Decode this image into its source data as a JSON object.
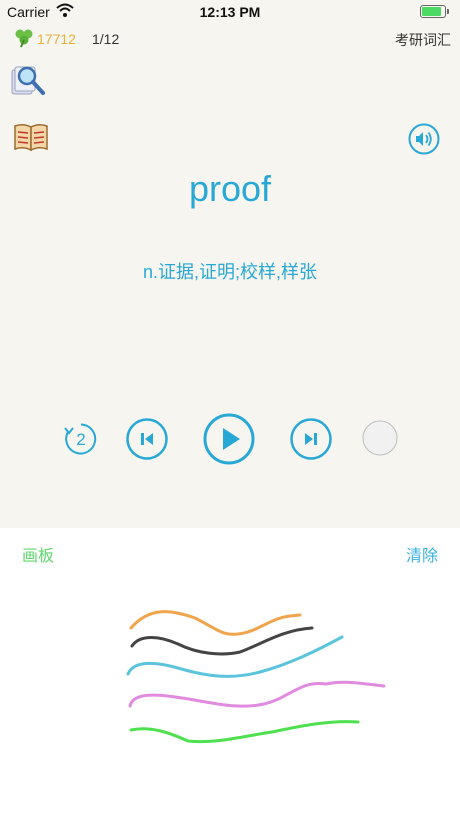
{
  "status_bar": {
    "carrier": "Carrier",
    "time": "12:13 PM"
  },
  "header": {
    "score": "17712",
    "progress": "1/12",
    "wordbook": "考研词汇"
  },
  "card": {
    "word": "proof",
    "definition": "n.证据,证明;校样,样张"
  },
  "controls": {
    "repeat_count": "2"
  },
  "board": {
    "label": "画板",
    "clear_label": "清除"
  },
  "colors": {
    "accent": "#28a8d4",
    "score": "#e9b23c",
    "board_label": "#5fd96b",
    "clear": "#3ab0e1",
    "stroke_orange": "#f0a44c",
    "stroke_black": "#444444",
    "stroke_cyan": "#5bc4dc",
    "stroke_pink": "#e08be0",
    "stroke_green": "#4ee04e"
  }
}
